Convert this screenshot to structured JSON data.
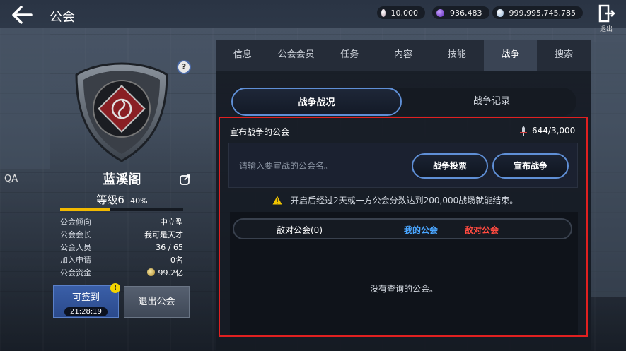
{
  "header": {
    "title": "公会",
    "currencies": [
      {
        "value": "10,000",
        "icon": "pearl-icon",
        "color": "#d9c6cf"
      },
      {
        "value": "936,483",
        "icon": "amethyst-icon",
        "color": "#8a54e0"
      },
      {
        "value": "999,995,745,785",
        "icon": "diamond-icon",
        "color": "#b9d3ea"
      }
    ],
    "exit_label": "退出"
  },
  "guild": {
    "side_label": "QA",
    "name": "蓝溪阁",
    "level_text": "等级6",
    "level_pct_text": ".40%",
    "level_progress": 0.4,
    "help_glyph": "?",
    "info": [
      {
        "label": "公会倾向",
        "value": "中立型"
      },
      {
        "label": "公会会长",
        "value": "我可是天才"
      },
      {
        "label": "公会人员",
        "value": "36 / 65"
      },
      {
        "label": "加入申请",
        "value": "0名"
      },
      {
        "label": "公会资金",
        "value": "99.2亿"
      }
    ],
    "sign_label": "可签到",
    "sign_time": "21:28:19",
    "notice_glyph": "!",
    "quit_label": "退出公会"
  },
  "tabs": [
    "信息",
    "公会会员",
    "任务",
    "内容",
    "技能",
    "战争",
    "搜索"
  ],
  "active_tab": "战争",
  "war": {
    "seg_status": "战争战况",
    "seg_record": "战争记录",
    "declared_header": "宣布战争的公会",
    "count": "644/3,000",
    "search_placeholder": "请输入要宣战的公会名。",
    "vote_label": "战争投票",
    "declare_label": "宣布战争",
    "warning": "开启后经过2天或一方公会分数达到200,000战场就能结束。",
    "list_headers": {
      "enemy": "敌对公会(0)",
      "mine": "我的公会",
      "theirs": "敌对公会"
    },
    "empty_text": "没有查询的公会。"
  },
  "colors": {
    "accent_blue": "#5f8fd6",
    "my_guild": "#4aa6ff",
    "enemy_guild": "#ff4a40",
    "highlight_box": "#e02020",
    "xp_fill": "#f2b900"
  }
}
